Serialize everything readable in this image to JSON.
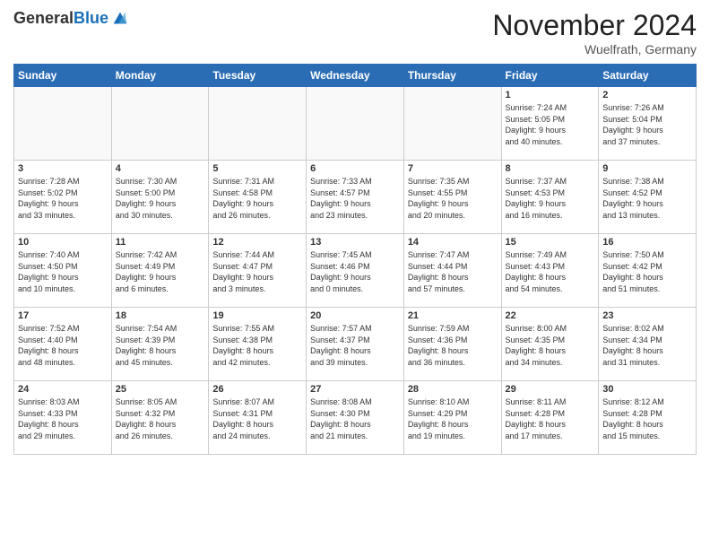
{
  "header": {
    "logo_general": "General",
    "logo_blue": "Blue",
    "month_title": "November 2024",
    "location": "Wuelfrath, Germany"
  },
  "weekdays": [
    "Sunday",
    "Monday",
    "Tuesday",
    "Wednesday",
    "Thursday",
    "Friday",
    "Saturday"
  ],
  "weeks": [
    [
      {
        "day": "",
        "info": ""
      },
      {
        "day": "",
        "info": ""
      },
      {
        "day": "",
        "info": ""
      },
      {
        "day": "",
        "info": ""
      },
      {
        "day": "",
        "info": ""
      },
      {
        "day": "1",
        "info": "Sunrise: 7:24 AM\nSunset: 5:05 PM\nDaylight: 9 hours\nand 40 minutes."
      },
      {
        "day": "2",
        "info": "Sunrise: 7:26 AM\nSunset: 5:04 PM\nDaylight: 9 hours\nand 37 minutes."
      }
    ],
    [
      {
        "day": "3",
        "info": "Sunrise: 7:28 AM\nSunset: 5:02 PM\nDaylight: 9 hours\nand 33 minutes."
      },
      {
        "day": "4",
        "info": "Sunrise: 7:30 AM\nSunset: 5:00 PM\nDaylight: 9 hours\nand 30 minutes."
      },
      {
        "day": "5",
        "info": "Sunrise: 7:31 AM\nSunset: 4:58 PM\nDaylight: 9 hours\nand 26 minutes."
      },
      {
        "day": "6",
        "info": "Sunrise: 7:33 AM\nSunset: 4:57 PM\nDaylight: 9 hours\nand 23 minutes."
      },
      {
        "day": "7",
        "info": "Sunrise: 7:35 AM\nSunset: 4:55 PM\nDaylight: 9 hours\nand 20 minutes."
      },
      {
        "day": "8",
        "info": "Sunrise: 7:37 AM\nSunset: 4:53 PM\nDaylight: 9 hours\nand 16 minutes."
      },
      {
        "day": "9",
        "info": "Sunrise: 7:38 AM\nSunset: 4:52 PM\nDaylight: 9 hours\nand 13 minutes."
      }
    ],
    [
      {
        "day": "10",
        "info": "Sunrise: 7:40 AM\nSunset: 4:50 PM\nDaylight: 9 hours\nand 10 minutes."
      },
      {
        "day": "11",
        "info": "Sunrise: 7:42 AM\nSunset: 4:49 PM\nDaylight: 9 hours\nand 6 minutes."
      },
      {
        "day": "12",
        "info": "Sunrise: 7:44 AM\nSunset: 4:47 PM\nDaylight: 9 hours\nand 3 minutes."
      },
      {
        "day": "13",
        "info": "Sunrise: 7:45 AM\nSunset: 4:46 PM\nDaylight: 9 hours\nand 0 minutes."
      },
      {
        "day": "14",
        "info": "Sunrise: 7:47 AM\nSunset: 4:44 PM\nDaylight: 8 hours\nand 57 minutes."
      },
      {
        "day": "15",
        "info": "Sunrise: 7:49 AM\nSunset: 4:43 PM\nDaylight: 8 hours\nand 54 minutes."
      },
      {
        "day": "16",
        "info": "Sunrise: 7:50 AM\nSunset: 4:42 PM\nDaylight: 8 hours\nand 51 minutes."
      }
    ],
    [
      {
        "day": "17",
        "info": "Sunrise: 7:52 AM\nSunset: 4:40 PM\nDaylight: 8 hours\nand 48 minutes."
      },
      {
        "day": "18",
        "info": "Sunrise: 7:54 AM\nSunset: 4:39 PM\nDaylight: 8 hours\nand 45 minutes."
      },
      {
        "day": "19",
        "info": "Sunrise: 7:55 AM\nSunset: 4:38 PM\nDaylight: 8 hours\nand 42 minutes."
      },
      {
        "day": "20",
        "info": "Sunrise: 7:57 AM\nSunset: 4:37 PM\nDaylight: 8 hours\nand 39 minutes."
      },
      {
        "day": "21",
        "info": "Sunrise: 7:59 AM\nSunset: 4:36 PM\nDaylight: 8 hours\nand 36 minutes."
      },
      {
        "day": "22",
        "info": "Sunrise: 8:00 AM\nSunset: 4:35 PM\nDaylight: 8 hours\nand 34 minutes."
      },
      {
        "day": "23",
        "info": "Sunrise: 8:02 AM\nSunset: 4:34 PM\nDaylight: 8 hours\nand 31 minutes."
      }
    ],
    [
      {
        "day": "24",
        "info": "Sunrise: 8:03 AM\nSunset: 4:33 PM\nDaylight: 8 hours\nand 29 minutes."
      },
      {
        "day": "25",
        "info": "Sunrise: 8:05 AM\nSunset: 4:32 PM\nDaylight: 8 hours\nand 26 minutes."
      },
      {
        "day": "26",
        "info": "Sunrise: 8:07 AM\nSunset: 4:31 PM\nDaylight: 8 hours\nand 24 minutes."
      },
      {
        "day": "27",
        "info": "Sunrise: 8:08 AM\nSunset: 4:30 PM\nDaylight: 8 hours\nand 21 minutes."
      },
      {
        "day": "28",
        "info": "Sunrise: 8:10 AM\nSunset: 4:29 PM\nDaylight: 8 hours\nand 19 minutes."
      },
      {
        "day": "29",
        "info": "Sunrise: 8:11 AM\nSunset: 4:28 PM\nDaylight: 8 hours\nand 17 minutes."
      },
      {
        "day": "30",
        "info": "Sunrise: 8:12 AM\nSunset: 4:28 PM\nDaylight: 8 hours\nand 15 minutes."
      }
    ]
  ]
}
